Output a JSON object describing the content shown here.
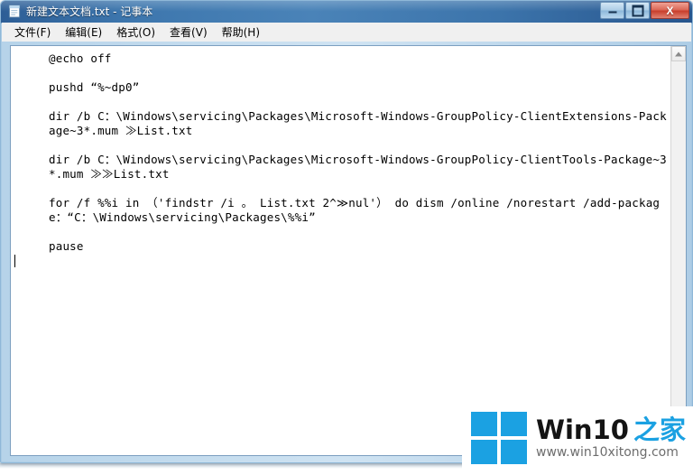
{
  "window": {
    "title": "新建文本文档.txt - 记事本",
    "icon": "notepad-document-icon",
    "controls": {
      "minimize": "−",
      "maximize": "□",
      "close": "X"
    }
  },
  "menubar": {
    "items": [
      {
        "label": "文件(F)"
      },
      {
        "label": "编辑(E)"
      },
      {
        "label": "格式(O)"
      },
      {
        "label": "查看(V)"
      },
      {
        "label": "帮助(H)"
      }
    ]
  },
  "editor": {
    "lines": [
      "@echo off",
      "",
      "pushd “%~dp0”",
      "",
      "dir /b C：\\Windows\\servicing\\Packages\\Microsoft-Windows-GroupPolicy-ClientExtensions-Package~3*.mum ≫List.txt",
      "",
      "dir /b C：\\Windows\\servicing\\Packages\\Microsoft-Windows-GroupPolicy-ClientTools-Package~3*.mum ≫≫List.txt",
      "",
      "for /f %%i in （'findstr /i 。 List.txt 2^≫nul'） do dism /online /norestart /add-package：“C：\\Windows\\servicing\\Packages\\%%i”",
      "",
      "pause"
    ],
    "caret_visible": true
  },
  "scrollbar": {
    "up_arrow": "scroll-up-arrow",
    "down_arrow": "scroll-down-arrow"
  },
  "watermark": {
    "brand": "Win10",
    "brand_cn": "之家",
    "url": "www.win10xitong.com",
    "logo_color": "#1BA1E2",
    "brand_color": "#141414"
  }
}
